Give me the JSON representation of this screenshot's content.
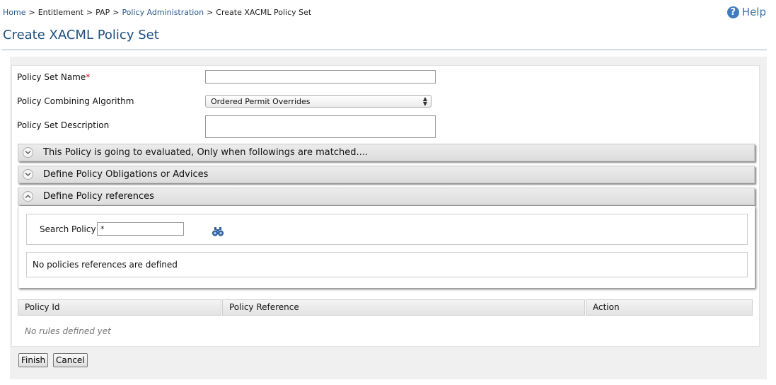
{
  "breadcrumb": {
    "home": "Home",
    "entitlement": "Entitlement",
    "pap": "PAP",
    "policy_admin": "Policy Administration",
    "current": "Create XACML Policy Set",
    "separator": ">"
  },
  "help": {
    "label": "Help",
    "icon": "?"
  },
  "page_title": "Create XACML Policy Set",
  "form": {
    "name_label": "Policy Set Name",
    "required_mark": "*",
    "name_value": "",
    "algorithm_label": "Policy Combining Algorithm",
    "algorithm_value": "Ordered Permit Overrides",
    "description_label": "Policy Set Description",
    "description_value": ""
  },
  "sections": {
    "target": "This Policy is going to evaluated, Only when followings are matched....",
    "obligations": "Define Policy Obligations or Advices",
    "references": "Define Policy references"
  },
  "search": {
    "label": "Search Policy",
    "value": "*"
  },
  "empty_message": "No policies references are defined",
  "table": {
    "headers": [
      "Policy Id",
      "Policy Reference",
      "Action"
    ],
    "empty_text": "No rules defined yet"
  },
  "buttons": {
    "finish": "Finish",
    "cancel": "Cancel"
  },
  "colors": {
    "title": "#1f4f7f",
    "link": "#2a5a8c",
    "help_icon": "#3f7cc0",
    "required": "#cc0000"
  }
}
